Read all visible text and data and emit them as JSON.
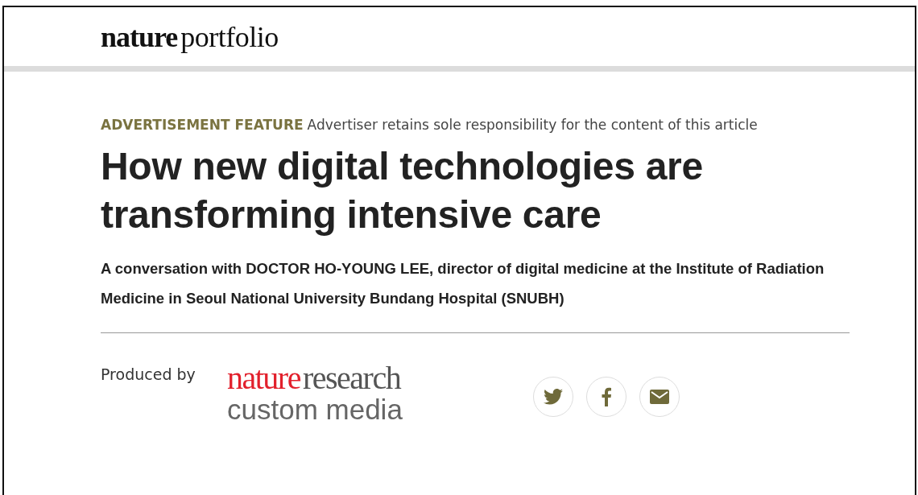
{
  "header": {
    "logo": {
      "bold": "nature",
      "regular": "portfolio"
    }
  },
  "article": {
    "label": "ADVERTISEMENT FEATURE",
    "disclaimer": "Advertiser retains sole responsibility for the content of this article",
    "title": "How new digital technologies are transforming intensive care",
    "subtitle": "A conversation with DOCTOR HO-YOUNG LEE, director of digital medicine at the Institute of Radiation Medicine in Seoul National University Bundang Hospital (SNUBH)"
  },
  "producer": {
    "label": "Produced by",
    "logo": {
      "brand": "nature",
      "word": "research",
      "line2": "custom media"
    }
  },
  "share": [
    {
      "kind": "bird"
    },
    {
      "kind": "f"
    },
    {
      "kind": "mail"
    }
  ]
}
